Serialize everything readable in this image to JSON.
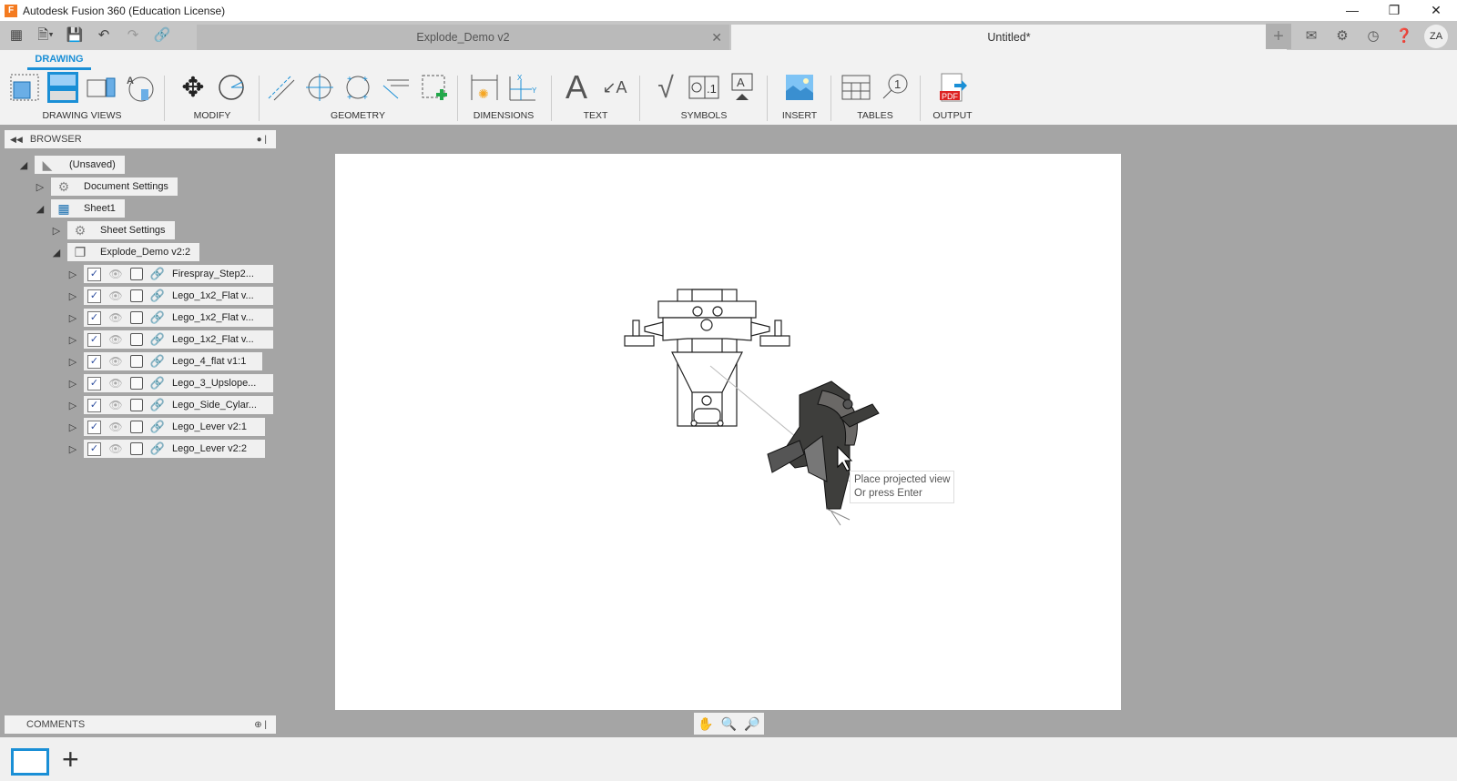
{
  "window": {
    "title": "Autodesk Fusion 360 (Education License)",
    "logo": "F"
  },
  "tabs": [
    {
      "label": "Explode_Demo v2",
      "active": false
    },
    {
      "label": "Untitled*",
      "active": true
    }
  ],
  "user": {
    "initials": "ZA"
  },
  "toolbar": {
    "workspace_tab": "DRAWING",
    "groups": [
      "DRAWING VIEWS",
      "MODIFY",
      "GEOMETRY",
      "DIMENSIONS",
      "TEXT",
      "SYMBOLS",
      "INSERT",
      "TABLES",
      "OUTPUT"
    ]
  },
  "browser": {
    "title": "BROWSER",
    "root": "(Unsaved)",
    "document_settings": "Document Settings",
    "sheet": "Sheet1",
    "sheet_settings": "Sheet Settings",
    "view": "Explode_Demo v2:2",
    "components": [
      "Firespray_Step2...",
      "Lego_1x2_Flat v...",
      "Lego_1x2_Flat v...",
      "Lego_1x2_Flat v...",
      "Lego_4_flat v1:1",
      "Lego_3_Upslope...",
      "Lego_Side_Cylar...",
      "Lego_Lever v2:1",
      "Lego_Lever v2:2"
    ]
  },
  "comments": {
    "title": "COMMENTS"
  },
  "tooltip": {
    "line1": "Place projected view",
    "line2": "Or press Enter"
  },
  "colors": {
    "accent": "#1a8fd6",
    "canvas": "#a5a5a5"
  }
}
